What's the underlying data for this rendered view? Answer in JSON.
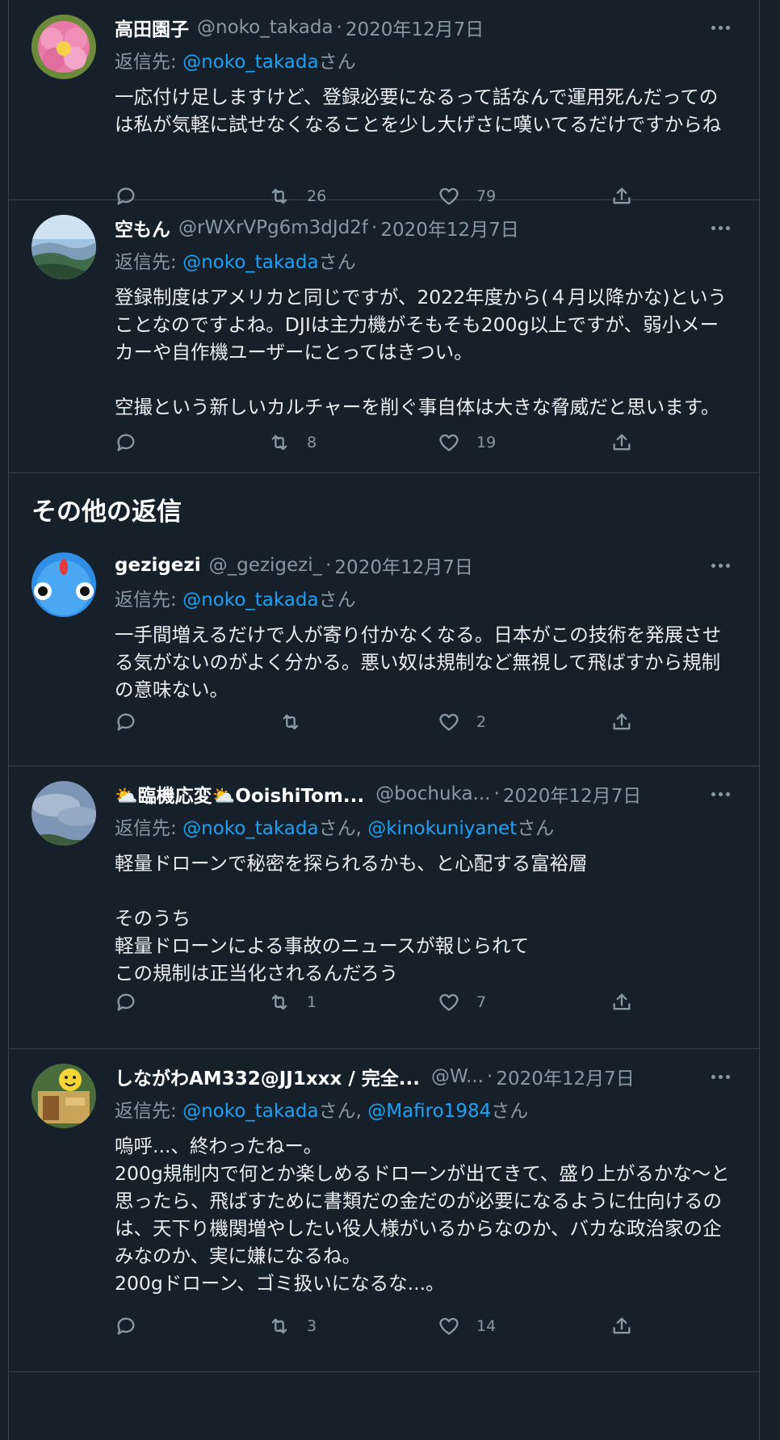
{
  "section_title": "その他の返信",
  "tweets": [
    {
      "name": "高田園子",
      "handle": "@noko_takada",
      "sep": "·",
      "date": "2020年12月7日",
      "reply_prefix": "返信先: ",
      "mentions": [
        {
          "mention": "@noko_takada",
          "suffix": "さん"
        }
      ],
      "text": "一応付け足しますけど、登録必要になるって話なんで運用死んだってのは私が気軽に試せなくなることを少し大げさに嘆いてるだけですからね",
      "retweets": "26",
      "likes": "79"
    },
    {
      "name": "空もん",
      "handle": "@rWXrVPg6m3dJd2f",
      "sep": "·",
      "date": "2020年12月7日",
      "reply_prefix": "返信先: ",
      "mentions": [
        {
          "mention": "@noko_takada",
          "suffix": "さん"
        }
      ],
      "text": "登録制度はアメリカと同じですが、2022年度から(４月以降かな)ということなのですよね。DJIは主力機がそもそも200g以上ですが、弱小メーカーや自作機ユーザーにとってはきつい。\n\n空撮という新しいカルチャーを削ぐ事自体は大きな脅威だと思います。",
      "retweets": "8",
      "likes": "19"
    },
    {
      "name": "gezigezi",
      "handle": "@_gezigezi_",
      "sep": "·",
      "date": "2020年12月7日",
      "reply_prefix": "返信先: ",
      "mentions": [
        {
          "mention": "@noko_takada",
          "suffix": "さん"
        }
      ],
      "text": "一手間増えるだけで人が寄り付かなくなる。日本がこの技術を発展させる気がないのがよく分かる。悪い奴は規制など無視して飛ばすから規制の意味ない。",
      "retweets": "",
      "likes": "2"
    },
    {
      "name": "⛅臨機応変⛅OoishiTom...",
      "handle": "@bochuka...",
      "sep": "·",
      "date": "2020年12月7日",
      "reply_prefix": "返信先: ",
      "mentions": [
        {
          "mention": "@noko_takada",
          "suffix": "さん, "
        },
        {
          "mention": "@kinokuniyanet",
          "suffix": "さん"
        }
      ],
      "text": "軽量ドローンで秘密を探られるかも、と心配する富裕層\n\nそのうち\n軽量ドローンによる事故のニュースが報じられて\nこの規制は正当化されるんだろう",
      "retweets": "1",
      "likes": "7"
    },
    {
      "name": "しながわAM332@JJ1xxx / 完全...",
      "handle": "@W...",
      "sep": "·",
      "date": "2020年12月7日",
      "reply_prefix": "返信先: ",
      "mentions": [
        {
          "mention": "@noko_takada",
          "suffix": "さん, "
        },
        {
          "mention": "@Mafiro1984",
          "suffix": "さん"
        }
      ],
      "text": "嗚呼...、終わったねー。\n200g規制内で何とか楽しめるドローンが出てきて、盛り上がるかな〜と思ったら、飛ばすために書類だの金だのが必要になるように仕向けるのは、天下り機関増やしたい役人様がいるからなのか、バカな政治家の企みなのか、実に嫌になるね。\n200gドローン、ゴミ扱いになるな...。",
      "retweets": "3",
      "likes": "14"
    }
  ],
  "colors": {
    "background": "#15202b",
    "border": "#38444d",
    "secondary_text": "#8899a6",
    "mention": "#1da1f2"
  }
}
